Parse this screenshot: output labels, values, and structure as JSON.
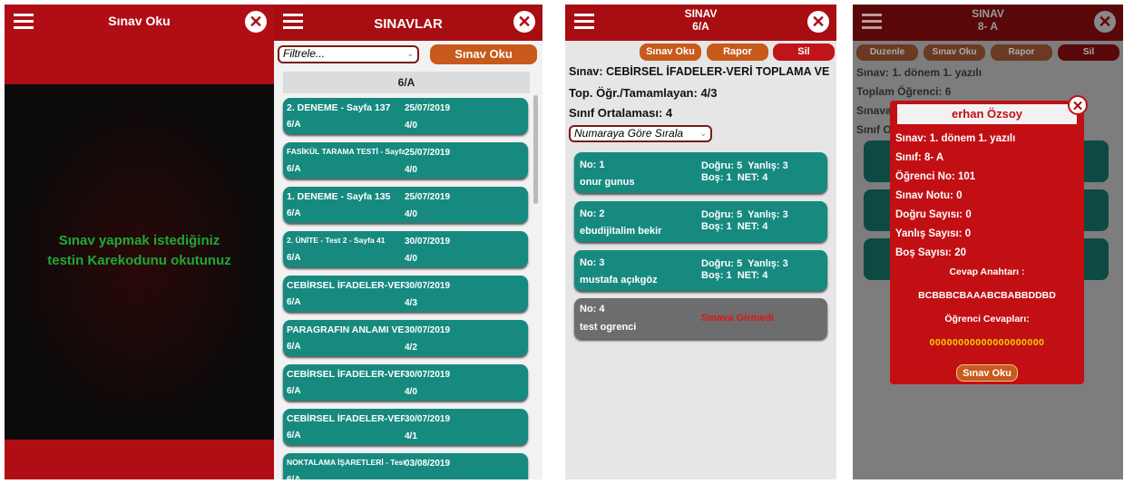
{
  "screen1": {
    "title": "Sınav Oku",
    "message_line1": "Sınav yapmak istediğiniz",
    "message_line2": "testin Karekodunu okutunuz"
  },
  "screen2": {
    "title": "SINAVLAR",
    "filter_placeholder": "Filtrele...",
    "read_button": "Sınav Oku",
    "group_header": "6/A",
    "exams": [
      {
        "name": "2. DENEME - Sayfa 137",
        "date": "25/07/2019",
        "class": "6/A",
        "score": "4/0"
      },
      {
        "name": "FASİKÜL TARAMA TESTİ - Sayfa",
        "date": "25/07/2019",
        "class": "6/A",
        "score": "4/0"
      },
      {
        "name": "1. DENEME - Sayfa 135",
        "date": "25/07/2019",
        "class": "6/A",
        "score": "4/0"
      },
      {
        "name": "2. ÜNİTE - Test 2 - Sayfa 41",
        "date": "30/07/2019",
        "class": "6/A",
        "score": "4/0"
      },
      {
        "name": "CEBİRSEL İFADELER-VERİ",
        "date": "30/07/2019",
        "class": "6/A",
        "score": "4/3"
      },
      {
        "name": "PARAGRAFIN ANLAMI VE",
        "date": "30/07/2019",
        "class": "6/A",
        "score": "4/2"
      },
      {
        "name": "CEBİRSEL İFADELER-VERİ",
        "date": "30/07/2019",
        "class": "6/A",
        "score": "4/0"
      },
      {
        "name": "CEBİRSEL İFADELER-VERİ",
        "date": "30/07/2019",
        "class": "6/A",
        "score": "4/1"
      },
      {
        "name": "NOKTALAMA İŞARETLERİ - Test",
        "date": "03/08/2019",
        "class": "6/A",
        "score": ""
      }
    ]
  },
  "screen3": {
    "title": "SINAV",
    "subtitle": "6/A",
    "btn_read": "Sınav Oku",
    "btn_report": "Rapor",
    "btn_delete": "Sil",
    "exam_line": "Sınav: CEBİRSEL İFADELER-VERİ TOPLAMA VE",
    "total_line": "Top. Öğr./Tamamlayan: 4/3",
    "avg_line": "Sınıf Ortalaması: 4",
    "sort_value": "Numaraya Göre Sırala",
    "students": [
      {
        "no": "No: 1",
        "name": "onur gunus",
        "line1": "Doğru: 5  Yanlış: 3",
        "line2": "Boş: 1  NET: 4"
      },
      {
        "no": "No: 2",
        "name": "ebudijitalim bekir",
        "line1": "Doğru: 5  Yanlış: 3",
        "line2": "Boş: 1  NET: 4"
      },
      {
        "no": "No: 3",
        "name": "mustafa açıkgöz",
        "line1": "Doğru: 5  Yanlış: 3",
        "line2": "Boş: 1  NET: 4"
      }
    ],
    "absent": {
      "no": "No: 4",
      "name": "test ogrenci",
      "status": "Sınava Girmedi"
    }
  },
  "screen4": {
    "title": "SINAV",
    "subtitle": "8- A",
    "btn_edit": "Duzenle",
    "btn_read": "Sınav Oku",
    "btn_report": "Rapor",
    "btn_delete": "Sil",
    "bg_line1": "Sınav: 1. dönem 1. yazılı",
    "bg_line2": "Toplam Öğrenci: 6",
    "bg_line3": "Sınava",
    "bg_line4": "Sınıf O",
    "popup": {
      "title": "erhan Özsoy",
      "exam": "Sınav: 1. dönem 1. yazılı",
      "class": "Sınıf: 8- A",
      "student_no": "Öğrenci No: 101",
      "grade": "Sınav Notu: 0",
      "correct": "Doğru Sayısı: 0",
      "wrong": "Yanlış Sayısı: 0",
      "blank": "Boş Sayısı: 20",
      "key_label": "Cevap Anahtarı :",
      "key": "BCBBBCBAAABCBABBDDBD",
      "answers_label": "Öğrenci Cevapları:",
      "answers": "00000000000000000000",
      "button": "Sınav Oku"
    }
  },
  "colors": {
    "header_red": "#a80d12",
    "teal": "#178a80",
    "orange": "#c85a1c",
    "green_text": "#1fa836",
    "yellow_text": "#f5d000"
  }
}
